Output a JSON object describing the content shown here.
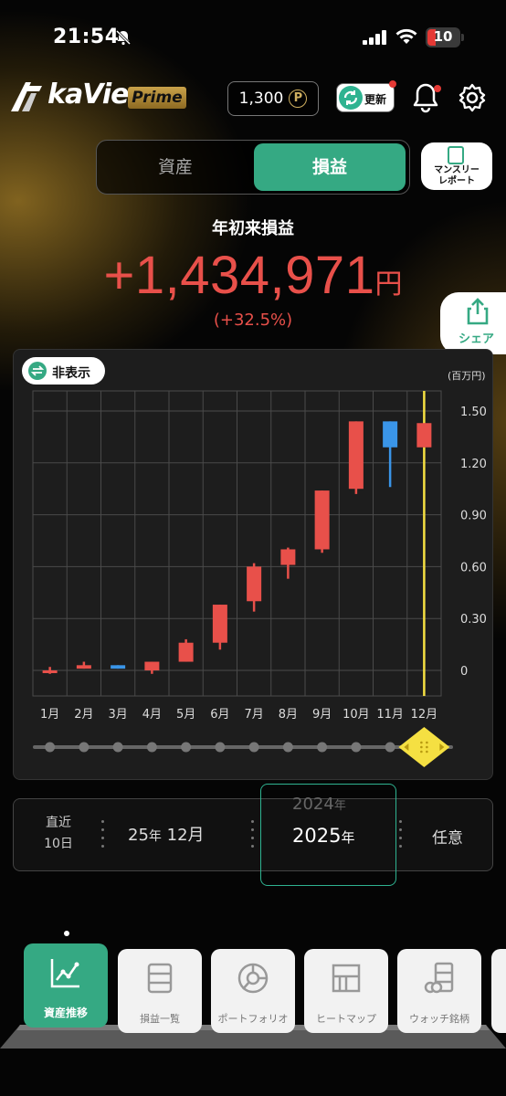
{
  "status_bar": {
    "time": "21:54",
    "battery": "10",
    "icons": [
      "bell-slash-icon",
      "signal-icon",
      "wifi-icon",
      "battery-icon"
    ]
  },
  "header": {
    "logo": "kaView",
    "badge": "Prime",
    "points": "1,300",
    "points_symbol": "P",
    "update_label": "更新",
    "icons": [
      "bell-icon",
      "gear-icon"
    ]
  },
  "segment": {
    "asset": "資産",
    "pl": "損益",
    "selected": "損益"
  },
  "monthly_report": {
    "line1": "マンスリー",
    "line2": "レポート"
  },
  "summary": {
    "label": "年初来損益",
    "value": "+1,434,971",
    "unit": "円",
    "percent": "(+32.5%)"
  },
  "share_label": "シェア",
  "chart_controls": {
    "hide_label": "非表示"
  },
  "chart_data": {
    "type": "candlestick",
    "unit_label": "(百万円)",
    "y_ticks": [
      "1.50",
      "1.20",
      "0.90",
      "0.60",
      "0.30",
      "0"
    ],
    "ylim": [
      0,
      1.5
    ],
    "categories": [
      "1月",
      "2月",
      "3月",
      "4月",
      "5月",
      "6月",
      "7月",
      "8月",
      "9月",
      "10月",
      "11月",
      "12月"
    ],
    "candles": [
      {
        "open": 0.0,
        "close": 0.0,
        "high": 0.02,
        "low": -0.02,
        "color": "red"
      },
      {
        "open": 0.01,
        "close": 0.03,
        "high": 0.05,
        "low": 0.01,
        "color": "red"
      },
      {
        "open": 0.03,
        "close": 0.01,
        "high": 0.03,
        "low": 0.01,
        "color": "blue"
      },
      {
        "open": 0.0,
        "close": 0.05,
        "high": 0.05,
        "low": -0.02,
        "color": "red"
      },
      {
        "open": 0.05,
        "close": 0.16,
        "high": 0.18,
        "low": 0.05,
        "color": "red"
      },
      {
        "open": 0.16,
        "close": 0.38,
        "high": 0.38,
        "low": 0.12,
        "color": "red"
      },
      {
        "open": 0.4,
        "close": 0.6,
        "high": 0.62,
        "low": 0.34,
        "color": "red"
      },
      {
        "open": 0.61,
        "close": 0.7,
        "high": 0.71,
        "low": 0.53,
        "color": "red"
      },
      {
        "open": 0.7,
        "close": 1.04,
        "high": 1.04,
        "low": 0.68,
        "color": "red"
      },
      {
        "open": 1.05,
        "close": 1.44,
        "high": 1.44,
        "low": 1.02,
        "color": "red"
      },
      {
        "open": 1.44,
        "close": 1.29,
        "high": 1.44,
        "low": 1.06,
        "color": "blue"
      },
      {
        "open": 1.29,
        "close": 1.43,
        "high": 1.43,
        "low": 1.29,
        "color": "red"
      }
    ],
    "highlight_index": 11,
    "colors": {
      "up": "#e8504a",
      "down": "#3a95e8",
      "highlight": "#f5e042",
      "grid": "#4a4a4a"
    },
    "slider_selected_index": 11
  },
  "period_picker": {
    "recent_line1": "直近",
    "recent_line2": "10日",
    "month_year": "25",
    "month_year_suffix": "年",
    "month": "12月",
    "prev_year": "2024",
    "prev_year_suffix": "年",
    "year": "2025",
    "year_suffix": "年",
    "free": "任意"
  },
  "bottom_nav": {
    "tabs": [
      {
        "label": "資産推移",
        "icon": "line-chart-icon",
        "active": true
      },
      {
        "label": "損益一覧",
        "icon": "list-icon",
        "active": false
      },
      {
        "label": "ポートフォリオ",
        "icon": "pie-chart-icon",
        "active": false
      },
      {
        "label": "ヒートマップ",
        "icon": "heatmap-icon",
        "active": false
      },
      {
        "label": "ウォッチ銘柄",
        "icon": "watchlist-icon",
        "active": false
      },
      {
        "label": "",
        "icon": "more-icon",
        "active": false
      }
    ]
  }
}
